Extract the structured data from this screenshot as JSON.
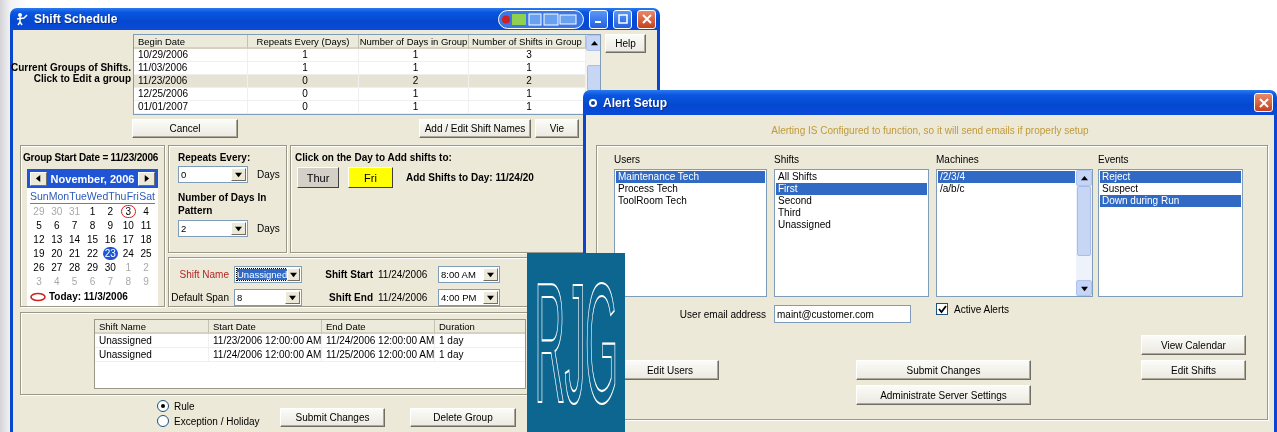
{
  "shift_window": {
    "title": "Shift Schedule",
    "groups_label": [
      "Current Groups of Shifts.",
      "Click to Edit a group"
    ],
    "groups_table": {
      "columns": [
        "Begin Date",
        "Repeats Every  (Days)",
        "Number of Days in Group",
        "Number of Shifts in Group"
      ],
      "rows": [
        {
          "cells": [
            "10/29/2006",
            "1",
            "1",
            "3"
          ],
          "selected": false
        },
        {
          "cells": [
            "11/03/2006",
            "1",
            "1",
            "1"
          ],
          "selected": false
        },
        {
          "cells": [
            "11/23/2006",
            "0",
            "2",
            "2"
          ],
          "selected": true
        },
        {
          "cells": [
            "12/25/2006",
            "0",
            "1",
            "1"
          ],
          "selected": false
        },
        {
          "cells": [
            "01/01/2007",
            "0",
            "1",
            "1"
          ],
          "selected": false
        }
      ]
    },
    "help_button": "Help",
    "cancel_button": "Cancel",
    "add_edit_button": "Add / Edit Shift Names",
    "view_button": "Vie",
    "group_start": "Group Start Date = 11/23/2006",
    "calendar": {
      "month": "November, 2006",
      "weekdays": [
        "Sun",
        "Mon",
        "Tue",
        "Wed",
        "Thu",
        "Fri",
        "Sat"
      ],
      "days": [
        {
          "day": "29",
          "other_month": true,
          "today": false,
          "selected": false
        },
        {
          "day": "30",
          "other_month": true,
          "today": false,
          "selected": false
        },
        {
          "day": "31",
          "other_month": true,
          "today": false,
          "selected": false
        },
        {
          "day": "1",
          "other_month": false,
          "today": false,
          "selected": false
        },
        {
          "day": "2",
          "other_month": false,
          "today": false,
          "selected": false
        },
        {
          "day": "3",
          "other_month": false,
          "today": true,
          "selected": false
        },
        {
          "day": "4",
          "other_month": false,
          "today": false,
          "selected": false
        },
        {
          "day": "5",
          "other_month": false,
          "today": false,
          "selected": false
        },
        {
          "day": "6",
          "other_month": false,
          "today": false,
          "selected": false
        },
        {
          "day": "7",
          "other_month": false,
          "today": false,
          "selected": false
        },
        {
          "day": "8",
          "other_month": false,
          "today": false,
          "selected": false
        },
        {
          "day": "9",
          "other_month": false,
          "today": false,
          "selected": false
        },
        {
          "day": "10",
          "other_month": false,
          "today": false,
          "selected": false
        },
        {
          "day": "11",
          "other_month": false,
          "today": false,
          "selected": false
        },
        {
          "day": "12",
          "other_month": false,
          "today": false,
          "selected": false
        },
        {
          "day": "13",
          "other_month": false,
          "today": false,
          "selected": false
        },
        {
          "day": "14",
          "other_month": false,
          "today": false,
          "selected": false
        },
        {
          "day": "15",
          "other_month": false,
          "today": false,
          "selected": false
        },
        {
          "day": "16",
          "other_month": false,
          "today": false,
          "selected": false
        },
        {
          "day": "17",
          "other_month": false,
          "today": false,
          "selected": false
        },
        {
          "day": "18",
          "other_month": false,
          "today": false,
          "selected": false
        },
        {
          "day": "19",
          "other_month": false,
          "today": false,
          "selected": false
        },
        {
          "day": "20",
          "other_month": false,
          "today": false,
          "selected": false
        },
        {
          "day": "21",
          "other_month": false,
          "today": false,
          "selected": false
        },
        {
          "day": "22",
          "other_month": false,
          "today": false,
          "selected": false
        },
        {
          "day": "23",
          "other_month": false,
          "today": false,
          "selected": true
        },
        {
          "day": "24",
          "other_month": false,
          "today": false,
          "selected": false
        },
        {
          "day": "25",
          "other_month": false,
          "today": false,
          "selected": false
        },
        {
          "day": "26",
          "other_month": false,
          "today": false,
          "selected": false
        },
        {
          "day": "27",
          "other_month": false,
          "today": false,
          "selected": false
        },
        {
          "day": "28",
          "other_month": false,
          "today": false,
          "selected": false
        },
        {
          "day": "29",
          "other_month": false,
          "today": false,
          "selected": false
        },
        {
          "day": "30",
          "other_month": false,
          "today": false,
          "selected": false
        },
        {
          "day": "1",
          "other_month": true,
          "today": false,
          "selected": false
        },
        {
          "day": "2",
          "other_month": true,
          "today": false,
          "selected": false
        },
        {
          "day": "3",
          "other_month": true,
          "today": false,
          "selected": false
        },
        {
          "day": "4",
          "other_month": true,
          "today": false,
          "selected": false
        },
        {
          "day": "5",
          "other_month": true,
          "today": false,
          "selected": false
        },
        {
          "day": "6",
          "other_month": true,
          "today": false,
          "selected": false
        },
        {
          "day": "7",
          "other_month": true,
          "today": false,
          "selected": false
        },
        {
          "day": "8",
          "other_month": true,
          "today": false,
          "selected": false
        },
        {
          "day": "9",
          "other_month": true,
          "today": false,
          "selected": false
        }
      ],
      "today_label": "Today: 11/3/2006"
    },
    "repeats": {
      "label": "Repeats Every:",
      "value": "0",
      "unit": "Days"
    },
    "pattern": {
      "label": "Number of Days In Pattern",
      "value": "2",
      "unit": "Days"
    },
    "day_picker": {
      "title": "Click on the Day to Add shifts to:",
      "add_to": "Add Shifts to Day: 11/24/20",
      "days": [
        {
          "label": "Thur",
          "selected": false
        },
        {
          "label": "Fri",
          "selected": true
        }
      ]
    },
    "shift": {
      "name_label": "Shift Name",
      "name": {
        "value": "Unassigned",
        "highlighted": true
      },
      "span_label": "Default Span",
      "span": {
        "value": "8",
        "highlighted": false
      },
      "start_label": "Shift Start",
      "start_date": "11/24/2006",
      "start_time": {
        "value": "8:00 AM",
        "highlighted": false
      },
      "end_label": "Shift End",
      "end_date": "11/24/2006",
      "end_time": {
        "value": "4:00 PM",
        "highlighted": false
      }
    },
    "shifts_table": {
      "columns": [
        "Shift Name",
        "Start Date",
        "End Date",
        "Duration"
      ],
      "rows": [
        [
          "Unassigned",
          "11/23/2006 12:00:00 AM",
          "11/24/2006 12:00:00 AM",
          "1 day"
        ],
        [
          "Unassigned",
          "11/24/2006 12:00:00 AM",
          "11/25/2006 12:00:00 AM",
          "1 day"
        ]
      ]
    },
    "mode": [
      {
        "label": "Rule",
        "selected": true
      },
      {
        "label": "Exception / Holiday",
        "selected": false
      }
    ],
    "submit_button": "Submit Changes",
    "delete_button": "Delete Group"
  },
  "alert_window": {
    "title": "Alert Setup",
    "notice": "Alerting IS Configured to function, so it will send emails if properly setup",
    "lists": [
      {
        "label": "Users",
        "scrollbar": false,
        "items": [
          {
            "text": "Maintenance Tech",
            "selected": true
          },
          {
            "text": "Process Tech",
            "selected": false
          },
          {
            "text": "ToolRoom Tech",
            "selected": false
          }
        ]
      },
      {
        "label": "Shifts",
        "scrollbar": false,
        "items": [
          {
            "text": "All Shifts",
            "selected": false
          },
          {
            "text": "First",
            "selected": true
          },
          {
            "text": "Second",
            "selected": false
          },
          {
            "text": "Third",
            "selected": false
          },
          {
            "text": "Unassigned",
            "selected": false
          }
        ]
      },
      {
        "label": "Machines",
        "scrollbar": true,
        "items": [
          {
            "text": "/2/3/4",
            "selected": true
          },
          {
            "text": "/a/b/c",
            "selected": false
          }
        ]
      },
      {
        "label": "Events",
        "scrollbar": false,
        "items": [
          {
            "text": "Reject",
            "selected": true
          },
          {
            "text": "Suspect",
            "selected": false
          },
          {
            "text": "Down during Run",
            "selected": true
          }
        ]
      }
    ],
    "email_label": "User email address",
    "email_value": "maint@customer.com",
    "active_alerts": {
      "label": "Active Alerts",
      "checked": true
    },
    "buttons": {
      "view_calendar": "View Calendar",
      "edit_users": "Edit Users",
      "submit": "Submit Changes",
      "edit_shifts": "Edit Shifts",
      "administrate": "Administrate Server Settings"
    }
  },
  "logo": {
    "text": "RJG"
  }
}
